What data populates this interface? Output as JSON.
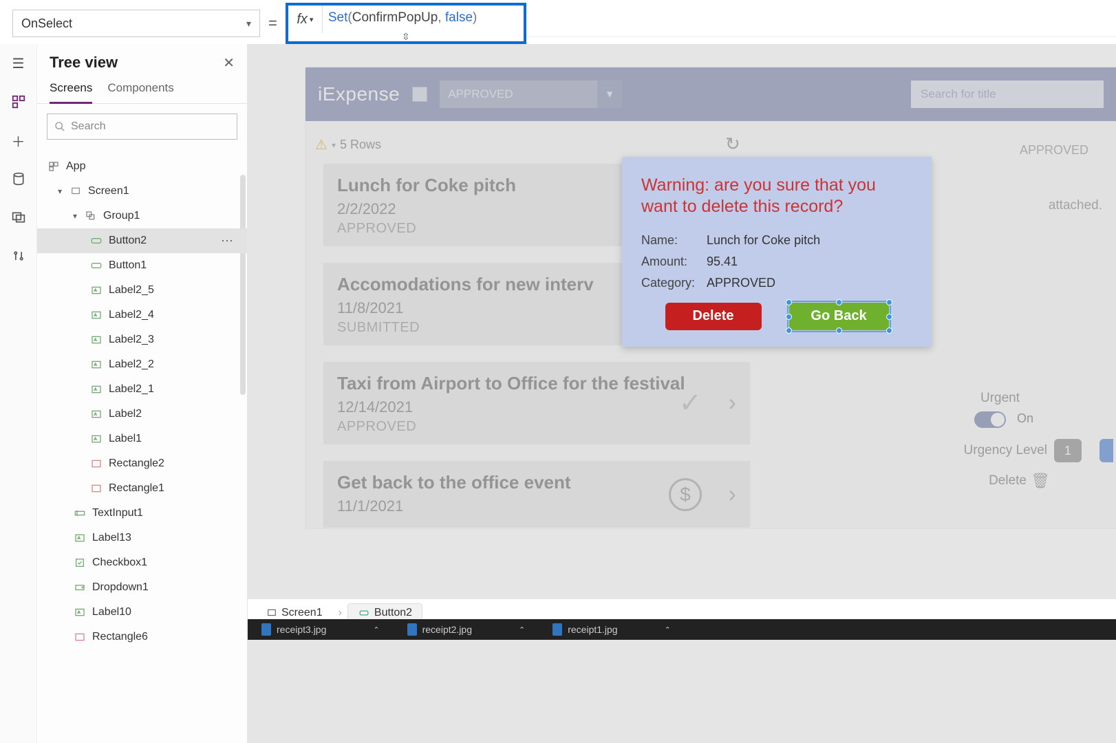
{
  "property_selector": "OnSelect",
  "formula": {
    "fn": "Set",
    "arg1": "ConfirmPopUp",
    "arg2": "false"
  },
  "tree": {
    "title": "Tree view",
    "tabs": [
      "Screens",
      "Components"
    ],
    "active_tab": "Screens",
    "search_placeholder": "Search",
    "nodes": [
      {
        "label": "App",
        "depth": 0,
        "icon": "app"
      },
      {
        "label": "Screen1",
        "depth": 1,
        "icon": "screen",
        "expanded": true
      },
      {
        "label": "Group1",
        "depth": 2,
        "icon": "group",
        "expanded": true
      },
      {
        "label": "Button2",
        "depth": 3,
        "icon": "button",
        "selected": true
      },
      {
        "label": "Button1",
        "depth": 3,
        "icon": "button"
      },
      {
        "label": "Label2_5",
        "depth": 3,
        "icon": "label"
      },
      {
        "label": "Label2_4",
        "depth": 3,
        "icon": "label"
      },
      {
        "label": "Label2_3",
        "depth": 3,
        "icon": "label"
      },
      {
        "label": "Label2_2",
        "depth": 3,
        "icon": "label"
      },
      {
        "label": "Label2_1",
        "depth": 3,
        "icon": "label"
      },
      {
        "label": "Label2",
        "depth": 3,
        "icon": "label"
      },
      {
        "label": "Label1",
        "depth": 3,
        "icon": "label"
      },
      {
        "label": "Rectangle2",
        "depth": 3,
        "icon": "rect"
      },
      {
        "label": "Rectangle1",
        "depth": 3,
        "icon": "rect"
      },
      {
        "label": "TextInput1",
        "depth": 2,
        "icon": "textinput"
      },
      {
        "label": "Label13",
        "depth": 2,
        "icon": "label"
      },
      {
        "label": "Checkbox1",
        "depth": 2,
        "icon": "checkbox"
      },
      {
        "label": "Dropdown1",
        "depth": 2,
        "icon": "dropdown"
      },
      {
        "label": "Label10",
        "depth": 2,
        "icon": "label"
      },
      {
        "label": "Rectangle6",
        "depth": 2,
        "icon": "rect"
      }
    ]
  },
  "app": {
    "title": "iExpense",
    "filter": "APPROVED",
    "search_placeholder": "Search for title",
    "row_count": "5 Rows",
    "approved_badge": "APPROVED",
    "items": [
      {
        "title": "Lunch for Coke pitch",
        "date": "2/2/2022",
        "status": "APPROVED"
      },
      {
        "title": "Accomodations for new interv",
        "date": "11/8/2021",
        "status": "SUBMITTED"
      },
      {
        "title": "Taxi from Airport to Office for the festival",
        "date": "12/14/2021",
        "status": "APPROVED",
        "check": true
      },
      {
        "title": "Get back to the office event",
        "date": "11/1/2021",
        "status": "",
        "dollar": true
      }
    ],
    "side": {
      "attached": "attached.",
      "urgent_label": "Urgent",
      "toggle_state": "On",
      "urgency_label": "Urgency Level",
      "urgency_value": "1",
      "delete_label": "Delete"
    }
  },
  "popup": {
    "warning": "Warning: are you sure that you want to delete this record?",
    "fields": [
      {
        "k": "Name:",
        "v": "Lunch for Coke pitch"
      },
      {
        "k": "Amount:",
        "v": "95.41"
      },
      {
        "k": "Category:",
        "v": "APPROVED"
      }
    ],
    "delete_label": "Delete",
    "back_label": "Go Back"
  },
  "breadcrumb": [
    {
      "label": "Screen1",
      "icon": "screen"
    },
    {
      "label": "Button2",
      "icon": "button",
      "active": true
    }
  ],
  "taskbar": [
    "receipt3.jpg",
    "receipt2.jpg",
    "receipt1.jpg"
  ]
}
